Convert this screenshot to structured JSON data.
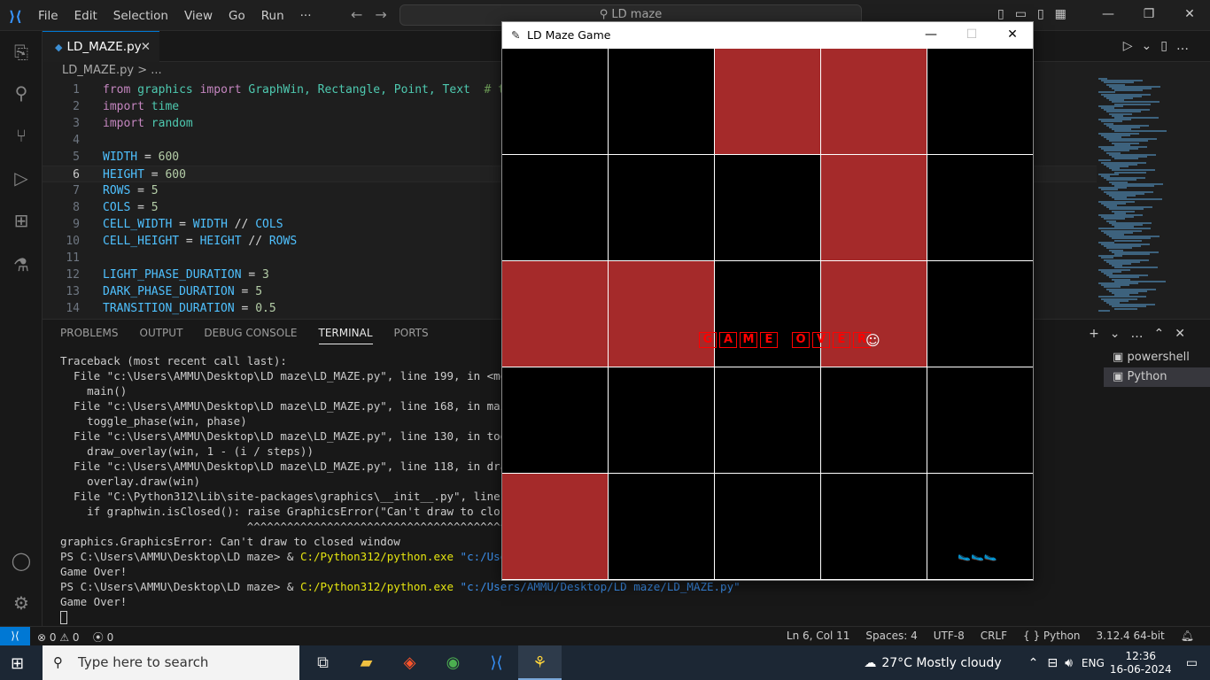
{
  "titlebar": {
    "menu": [
      "File",
      "Edit",
      "Selection",
      "View",
      "Go",
      "Run",
      "···"
    ],
    "search": "LD maze",
    "window_controls": [
      "—",
      "❐",
      "✕"
    ]
  },
  "tab": {
    "name": "LD_MAZE.py",
    "close": "✕"
  },
  "breadcrumb": "LD_MAZE.py > ...",
  "code_lines": [
    {
      "n": "1"
    },
    {
      "n": "2"
    },
    {
      "n": "3"
    },
    {
      "n": "4"
    },
    {
      "n": "5"
    },
    {
      "n": "6"
    },
    {
      "n": "7"
    },
    {
      "n": "8"
    },
    {
      "n": "9"
    },
    {
      "n": "10"
    },
    {
      "n": "11"
    },
    {
      "n": "12"
    },
    {
      "n": "13"
    },
    {
      "n": "14"
    }
  ],
  "code": {
    "l1_from": "from",
    "l1_mod": "graphics",
    "l1_import": "import",
    "l1_items": "GraphWin, Rectangle, Point, Text",
    "l1_comment": "# ty",
    "l2_import": "import",
    "l2_mod": "time",
    "l3_import": "import",
    "l3_mod": "random",
    "l5_var": "WIDTH",
    "l5_num": "600",
    "l6_var": "HEIGHT",
    "l6_num": "600",
    "l7_var": "ROWS",
    "l7_num": "5",
    "l8_var": "COLS",
    "l8_num": "5",
    "l9_var": "CELL_WIDTH",
    "l9_a": "WIDTH",
    "l9_b": "COLS",
    "l10_var": "CELL_HEIGHT",
    "l10_a": "HEIGHT",
    "l10_b": "ROWS",
    "l12_var": "LIGHT_PHASE_DURATION",
    "l12_num": "3",
    "l13_var": "DARK_PHASE_DURATION",
    "l13_num": "5",
    "l14_var": "TRANSITION_DURATION",
    "l14_num": "0.5"
  },
  "panel": {
    "tabs": [
      "PROBLEMS",
      "OUTPUT",
      "DEBUG CONSOLE",
      "TERMINAL",
      "PORTS"
    ],
    "active_tab": "TERMINAL",
    "terminals": [
      "powershell",
      "Python"
    ]
  },
  "terminal": {
    "lines": [
      "Traceback (most recent call last):",
      "  File \"c:\\Users\\AMMU\\Desktop\\LD maze\\LD_MAZE.py\", line 199, in <module>",
      "    main()",
      "  File \"c:\\Users\\AMMU\\Desktop\\LD maze\\LD_MAZE.py\", line 168, in main",
      "    toggle_phase(win, phase)",
      "  File \"c:\\Users\\AMMU\\Desktop\\LD maze\\LD_MAZE.py\", line 130, in toggle_",
      "    draw_overlay(win, 1 - (i / steps))",
      "  File \"c:\\Users\\AMMU\\Desktop\\LD maze\\LD_MAZE.py\", line 118, in draw_ov",
      "    overlay.draw(win)",
      "  File \"C:\\Python312\\Lib\\site-packages\\graphics\\__init__.py\", line 482,",
      "    if graphwin.isClosed(): raise GraphicsError(\"Can't draw to closed w",
      "                            ^^^^^^^^^^^^^^^^^^^^^^^^^^^^^^^^^^^^^^^^^^^^^",
      "graphics.GraphicsError: Can't draw to closed window"
    ],
    "prompt1": "PS C:\\Users\\AMMU\\Desktop\\LD maze> & ",
    "exe1": "C:/Python312/python.exe",
    "arg1": " \"c:/Users/A",
    "out1": "Game Over!",
    "prompt2": "PS C:\\Users\\AMMU\\Desktop\\LD maze> & ",
    "exe2": "C:/Python312/python.exe",
    "arg2": " \"c:/Users/AMMU/Desktop/LD maze/LD_MAZE.py\"",
    "out2": "Game Over!"
  },
  "status": {
    "errors": "⊗ 0 ⚠ 0",
    "ports": "⦿ 0",
    "position": "Ln 6, Col 11",
    "spaces": "Spaces: 4",
    "encoding": "UTF-8",
    "eol": "CRLF",
    "language": "{ } Python",
    "interpreter": "3.12.4 64-bit"
  },
  "taskbar": {
    "search_placeholder": "Type here to search",
    "weather": "27°C  Mostly cloudy",
    "lang": "ENG",
    "time": "12:36",
    "date": "16-06-2024"
  },
  "game": {
    "title": "LD Maze Game",
    "cells": [
      "black",
      "black",
      "red",
      "red",
      "black",
      "black",
      "black",
      "black",
      "red",
      "black",
      "red",
      "red",
      "black",
      "red",
      "black",
      "black",
      "black",
      "black",
      "black",
      "black",
      "red",
      "black",
      "black",
      "black",
      "black"
    ],
    "game_over_letters": [
      "G",
      "A",
      "M",
      "E",
      "",
      "O",
      "V",
      "E",
      "R"
    ],
    "smiley": "☺",
    "player": "🥿🥿🥿"
  },
  "colors": {
    "cell_red": "#a52a2a",
    "cell_black": "#000000",
    "accent": "#0078d4"
  }
}
